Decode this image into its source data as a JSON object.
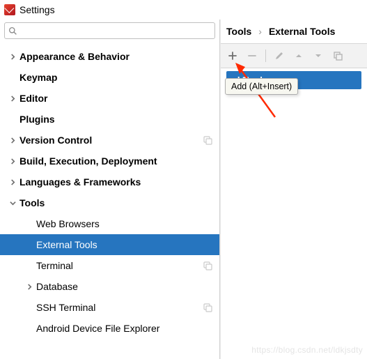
{
  "window": {
    "title": "Settings"
  },
  "search": {
    "placeholder": ""
  },
  "sidebar": {
    "items": [
      {
        "label": "Appearance & Behavior",
        "type": "top",
        "expandable": true,
        "expanded": false
      },
      {
        "label": "Keymap",
        "type": "top",
        "expandable": false
      },
      {
        "label": "Editor",
        "type": "top",
        "expandable": true,
        "expanded": false
      },
      {
        "label": "Plugins",
        "type": "top",
        "expandable": false
      },
      {
        "label": "Version Control",
        "type": "top",
        "expandable": true,
        "expanded": false,
        "project": true
      },
      {
        "label": "Build, Execution, Deployment",
        "type": "top",
        "expandable": true,
        "expanded": false
      },
      {
        "label": "Languages & Frameworks",
        "type": "top",
        "expandable": true,
        "expanded": false
      },
      {
        "label": "Tools",
        "type": "top",
        "expandable": true,
        "expanded": true
      },
      {
        "label": "Web Browsers",
        "type": "child"
      },
      {
        "label": "External Tools",
        "type": "child",
        "selected": true
      },
      {
        "label": "Terminal",
        "type": "child",
        "project": true
      },
      {
        "label": "Database",
        "type": "child",
        "expandable": true,
        "expanded": false
      },
      {
        "label": "SSH Terminal",
        "type": "child",
        "project": true
      },
      {
        "label": "Android Device File Explorer",
        "type": "child"
      }
    ]
  },
  "breadcrumb": {
    "root": "Tools",
    "sep": "›",
    "current": "External Tools"
  },
  "toolbar": {
    "add_tooltip": "Add (Alt+Insert)"
  },
  "list": {
    "group": "al Tools"
  },
  "watermark": "https://blog.csdn.net/ldkjsdty"
}
